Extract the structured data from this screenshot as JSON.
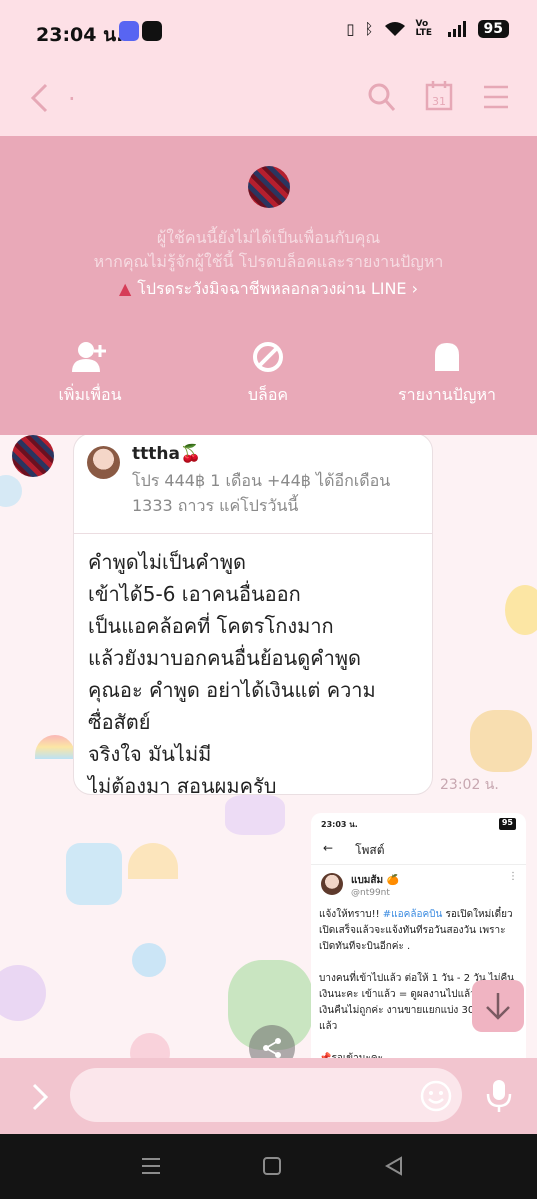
{
  "status_bar": {
    "time": "23:04 น.",
    "battery": "95",
    "network": "Vo LTE"
  },
  "header": {
    "chat_title": "."
  },
  "panel": {
    "line1": "ผู้ใช้คนนี้ยังไม่ได้เป็นเพื่อนกับคุณ",
    "line2": "หากคุณไม่รู้จักผู้ใช้นี้ โปรดบล็อคและรายงานปัญหา",
    "warning": "โปรดระวังมิจฉาชีพหลอกลวงผ่าน LINE",
    "actions": [
      {
        "label": "เพิ่มเพื่อน",
        "icon": "add-friend-icon"
      },
      {
        "label": "บล็อค",
        "icon": "block-icon"
      },
      {
        "label": "รายงานปัญหา",
        "icon": "report-icon"
      }
    ]
  },
  "message": {
    "quote_name": "tttha🍒",
    "quote_text": "โปร 444฿ 1 เดือน +44฿ ได้อีกเดือน 1333 ถาวร แค่โปรวันนี้",
    "text": "คำพูดไม่เป็นคำพูด\nเข้าได้5-6  เอาคนอื่นออก\nเป็นแอคล้อคที่ โคตรโกงมาก\nแล้วยังมาบอกคนอื่นย้อนดูคำพูด\nคุณอะ  คำพูด   อย่าได้เงินแต่ ความซื่อสัตย์\nจริงใจ มันไม่มี\nไม่ต้องมา สอนผมครับ",
    "time": "23:02 น."
  },
  "screenshot_msg": {
    "time": "23:03 น.",
    "battery": "95",
    "header": "โพสต์",
    "user_name": "แบมส้ม 🍊",
    "user_handle": "@nt99nt",
    "body_pre": "แจ้งให้ทราบ!! ",
    "hashtag": "#แอคล้อคบิน",
    "body_post": " รอเปิดใหม่เดี๋ยวเปิดเสร็จแล้วจะแจ้งทันทีรอวันสองวัน เพราะเปิดทันทีจะบินอีกค่ะ .\n\nบางคนที่เข้าไปแล้ว ต่อให้ 1 วัน - 2 วัน ไม่คืนเงินนะคะ เข้าแล้ว = ดูผลงานไปแล้ว จะมาเอาเงินคืนไม่ถูกค่ะ งานขายแยกแบ่ง 300-500฿ แล้ว\n\n📌รอเข้านะคะ"
  },
  "input": {
    "placeholder": ""
  },
  "colors": {
    "header_bg": "#fde0e6",
    "panel_bg": "#e9a9b8",
    "input_bar_bg": "#f2c5cf",
    "warning_red": "#d63d58"
  }
}
